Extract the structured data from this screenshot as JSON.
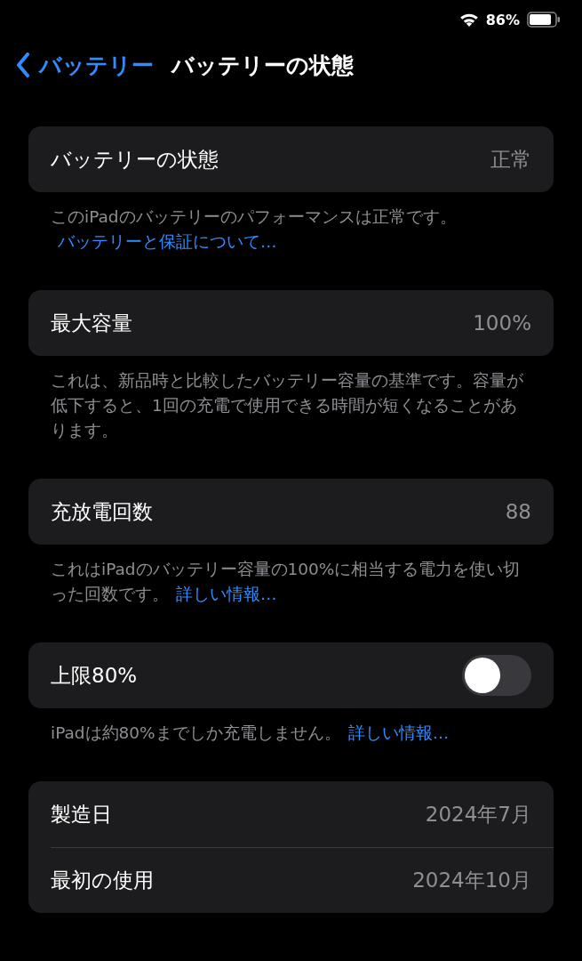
{
  "status_bar": {
    "battery": "86%"
  },
  "nav": {
    "back_label": "バッテリー",
    "title": "バッテリーの状態"
  },
  "sections": [
    {
      "rows": [
        {
          "kind": "value",
          "label": "バッテリーの状態",
          "value": "正常"
        }
      ],
      "footer": {
        "text": "このiPadのバッテリーのパフォーマンスは正常です。",
        "link": "バッテリーと保証について…"
      }
    },
    {
      "rows": [
        {
          "kind": "value",
          "label": "最大容量",
          "value": "100%"
        }
      ],
      "footer": {
        "text": "これは、新品時と比較したバッテリー容量の基準です。容量が低下すると、1回の充電で使用できる時間が短くなることがあります。"
      }
    },
    {
      "rows": [
        {
          "kind": "value",
          "label": "充放電回数",
          "value": "88"
        }
      ],
      "footer": {
        "text": "これはiPadのバッテリー容量の100%に相当する電力を使い切った回数です。",
        "link": "詳しい情報…"
      }
    },
    {
      "rows": [
        {
          "kind": "toggle",
          "label": "上限80%",
          "on": false
        }
      ],
      "footer": {
        "text": "iPadは約80%までしか充電しません。",
        "link": "詳しい情報…"
      }
    },
    {
      "rows": [
        {
          "kind": "value",
          "label": "製造日",
          "value": "2024年7月"
        },
        {
          "kind": "value",
          "label": "最初の使用",
          "value": "2024年10月"
        }
      ]
    }
  ]
}
